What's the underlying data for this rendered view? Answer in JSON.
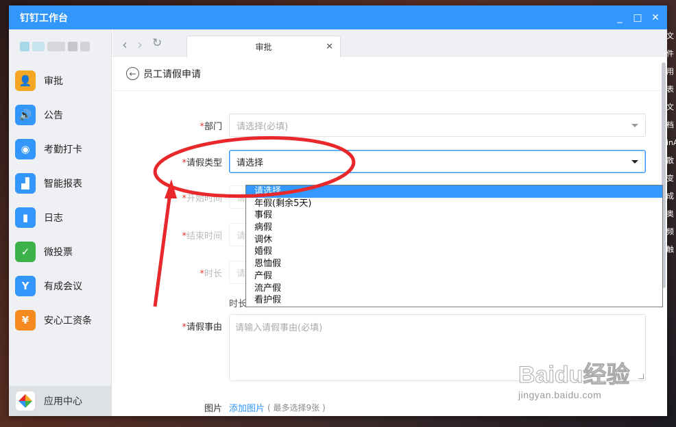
{
  "window": {
    "title": "钉钉工作台"
  },
  "window_controls": [
    "_",
    "□",
    "✕"
  ],
  "profile": {},
  "sidebar": {
    "items": [
      {
        "label": "审批",
        "icon": "user-icon",
        "color": "#f5a623"
      },
      {
        "label": "公告",
        "icon": "speaker-icon",
        "color": "#3296fa"
      },
      {
        "label": "考勤打卡",
        "icon": "location-icon",
        "color": "#3296fa"
      },
      {
        "label": "智能报表",
        "icon": "chart-icon",
        "color": "#3296fa"
      },
      {
        "label": "日志",
        "icon": "book-icon",
        "color": "#3296fa"
      },
      {
        "label": "微投票",
        "icon": "vote-icon",
        "color": "#3cb34a"
      },
      {
        "label": "有成会议",
        "icon": "meeting-icon",
        "color": "#3296fa"
      },
      {
        "label": "安心工资条",
        "icon": "payslip-icon",
        "color": "#f58a1f"
      }
    ],
    "app_center": "应用中心"
  },
  "tabbar": {
    "tab_label": "审批"
  },
  "page": {
    "title": "员工请假申请"
  },
  "form": {
    "department": {
      "label": "部门",
      "placeholder": "请选择(必填)"
    },
    "leave_type": {
      "label": "请假类型",
      "value": "请选择"
    },
    "start_time": {
      "label": "开始时间",
      "placeholder": "请"
    },
    "end_time": {
      "label": "结束时间",
      "placeholder": "请"
    },
    "duration": {
      "label": "时长",
      "placeholder": "请"
    },
    "duration_hint": "时长",
    "reason": {
      "label": "请假事由",
      "placeholder": "请输入请假事由(必填)"
    },
    "image": {
      "label": "图片",
      "link": "添加图片",
      "note": "( 最多选择9张 )"
    }
  },
  "dropdown": {
    "options": [
      "请选择",
      "年假(剩余5天)",
      "事假",
      "病假",
      "调休",
      "婚假",
      "恩恤假",
      "产假",
      "流产假",
      "看护假"
    ],
    "selected_index": 0
  },
  "watermark": {
    "logo": "Baidu经验",
    "url": "jingyan.baidu.com"
  },
  "desktop_side_text": [
    "文件",
    "用表",
    "文档",
    "inA",
    "散",
    "变成",
    "奥",
    "频",
    "触"
  ],
  "colors": {
    "accent": "#3296fa",
    "annotation": "#e8282b",
    "required": "#e33333"
  }
}
